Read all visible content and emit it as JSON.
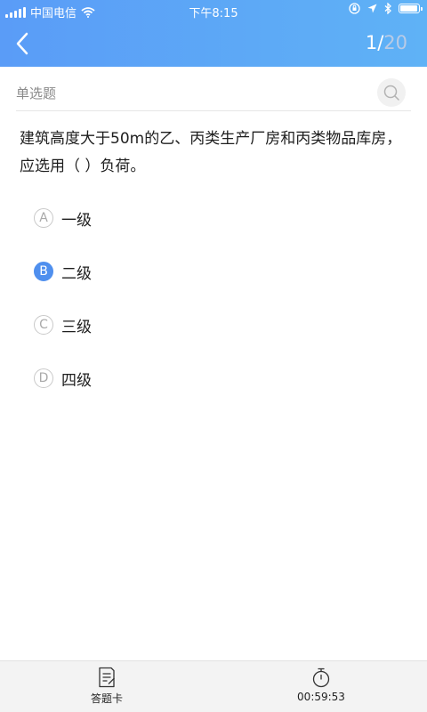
{
  "status_bar": {
    "carrier": "中国电信",
    "time": "下午8:15",
    "battery_level": 0.95
  },
  "header": {
    "current": "1",
    "separator": "/",
    "total": "20",
    "accent": "#5a9cf7"
  },
  "question": {
    "type": "单选题",
    "text": "建筑高度大于50m的乙、丙类生产厂房和丙类物品库房，应选用（ ）负荷。",
    "options": [
      {
        "letter": "A",
        "text": "一级",
        "selected": false
      },
      {
        "letter": "B",
        "text": "二级",
        "selected": true
      },
      {
        "letter": "C",
        "text": "三级",
        "selected": false
      },
      {
        "letter": "D",
        "text": "四级",
        "selected": false
      }
    ]
  },
  "footer": {
    "answer_card_label": "答题卡",
    "timer": "00:59:53"
  }
}
